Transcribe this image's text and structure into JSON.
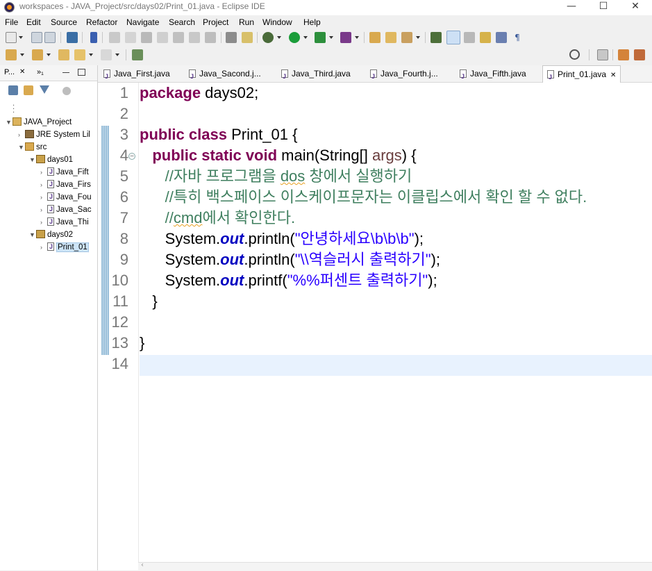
{
  "window": {
    "title": "workspaces - JAVA_Project/src/days02/Print_01.java - Eclipse IDE",
    "minimize": "—",
    "maximize": "☐",
    "close": "✕"
  },
  "menu": [
    "File",
    "Edit",
    "Source",
    "Refactor",
    "Navigate",
    "Search",
    "Project",
    "Run",
    "Window",
    "Help"
  ],
  "left_panel": {
    "tab1": "P...",
    "tab1_close": "✕",
    "tab2": "»₁",
    "tree": {
      "project": "JAVA_Project",
      "jre": "JRE System Lil",
      "src": "src",
      "pkg1": "days01",
      "pkg1_files": [
        "Java_Fift",
        "Java_Firs",
        "Java_Fou",
        "Java_Sac",
        "Java_Thi"
      ],
      "pkg2": "days02",
      "pkg2_files": [
        "Print_01"
      ]
    }
  },
  "editor": {
    "tabs": [
      "Java_First.java",
      "Java_Sacond.j...",
      "Java_Third.java",
      "Java_Fourth.j...",
      "Java_Fifth.java",
      "Print_01.java"
    ],
    "active_tab_close": "✕",
    "line_numbers": [
      "1",
      "2",
      "3",
      "4",
      "5",
      "6",
      "7",
      "8",
      "9",
      "10",
      "11",
      "12",
      "13",
      "14"
    ],
    "code": {
      "l1_kw": "package",
      "l1_rest": " days02;",
      "l3_kw": "public class",
      "l3_rest": " Print_01 {",
      "l4_indent": "   ",
      "l4_kw": "public static void",
      "l4_rest1": " main(String[] ",
      "l4_param": "args",
      "l4_rest2": ") {",
      "l5_a": "      //자바 프로그램을 ",
      "l5_b": "dos",
      "l5_c": " 창에서 실행하기",
      "l6": "      //특히 백스페이스 이스케이프문자는 이클립스에서 확인 할 수 없다.",
      "l7_a": "      //",
      "l7_b": "cmd",
      "l7_c": "에서 확인한다.",
      "l8_a": "      System.",
      "l8_field": "out",
      "l8_b": ".println(",
      "l8_str": "\"안녕하세요",
      "l8_esc": "\\b\\b\\b",
      "l8_str2": "\"",
      "l8_c": ");",
      "l9_a": "      System.",
      "l9_field": "out",
      "l9_b": ".println(",
      "l9_str1": "\"",
      "l9_esc": "\\\\",
      "l9_str2": "역슬러시 출력하기\"",
      "l9_c": ");",
      "l10_a": "      System.",
      "l10_field": "out",
      "l10_b": ".printf(",
      "l10_str1": "\"",
      "l10_esc": "%%",
      "l10_str2": "퍼센트 출력하기\"",
      "l10_c": ");",
      "l11": "   }",
      "l13": "}"
    }
  }
}
